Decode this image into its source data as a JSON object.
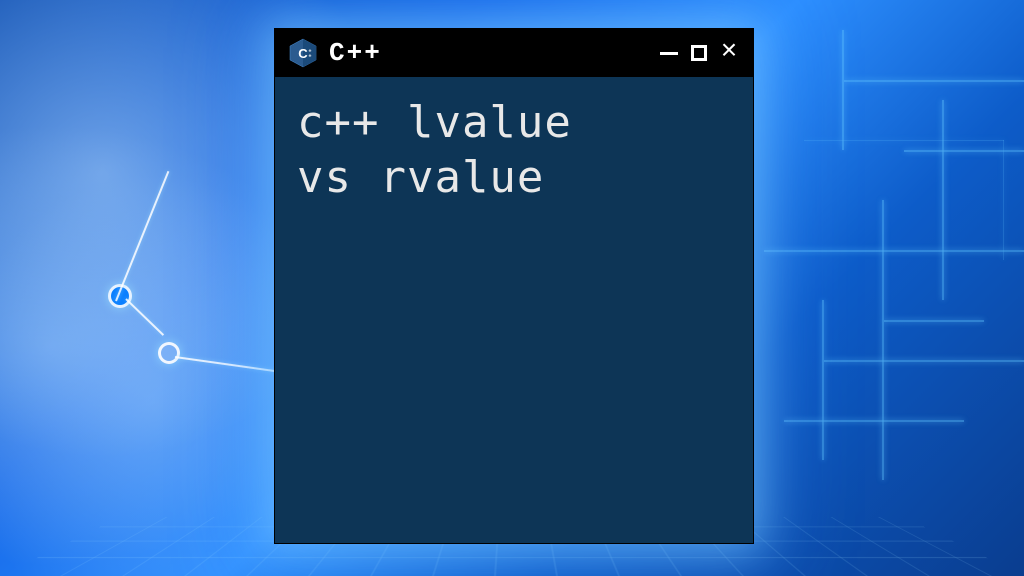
{
  "window": {
    "title": "C++",
    "icon_name": "cpp-icon",
    "body_line1": "c++ lvalue",
    "body_line2": "vs rvalue"
  },
  "colors": {
    "window_bg": "#0d3556",
    "titlebar_bg": "#000000",
    "text": "#e8e8e8",
    "accent": "#0a7fff"
  }
}
